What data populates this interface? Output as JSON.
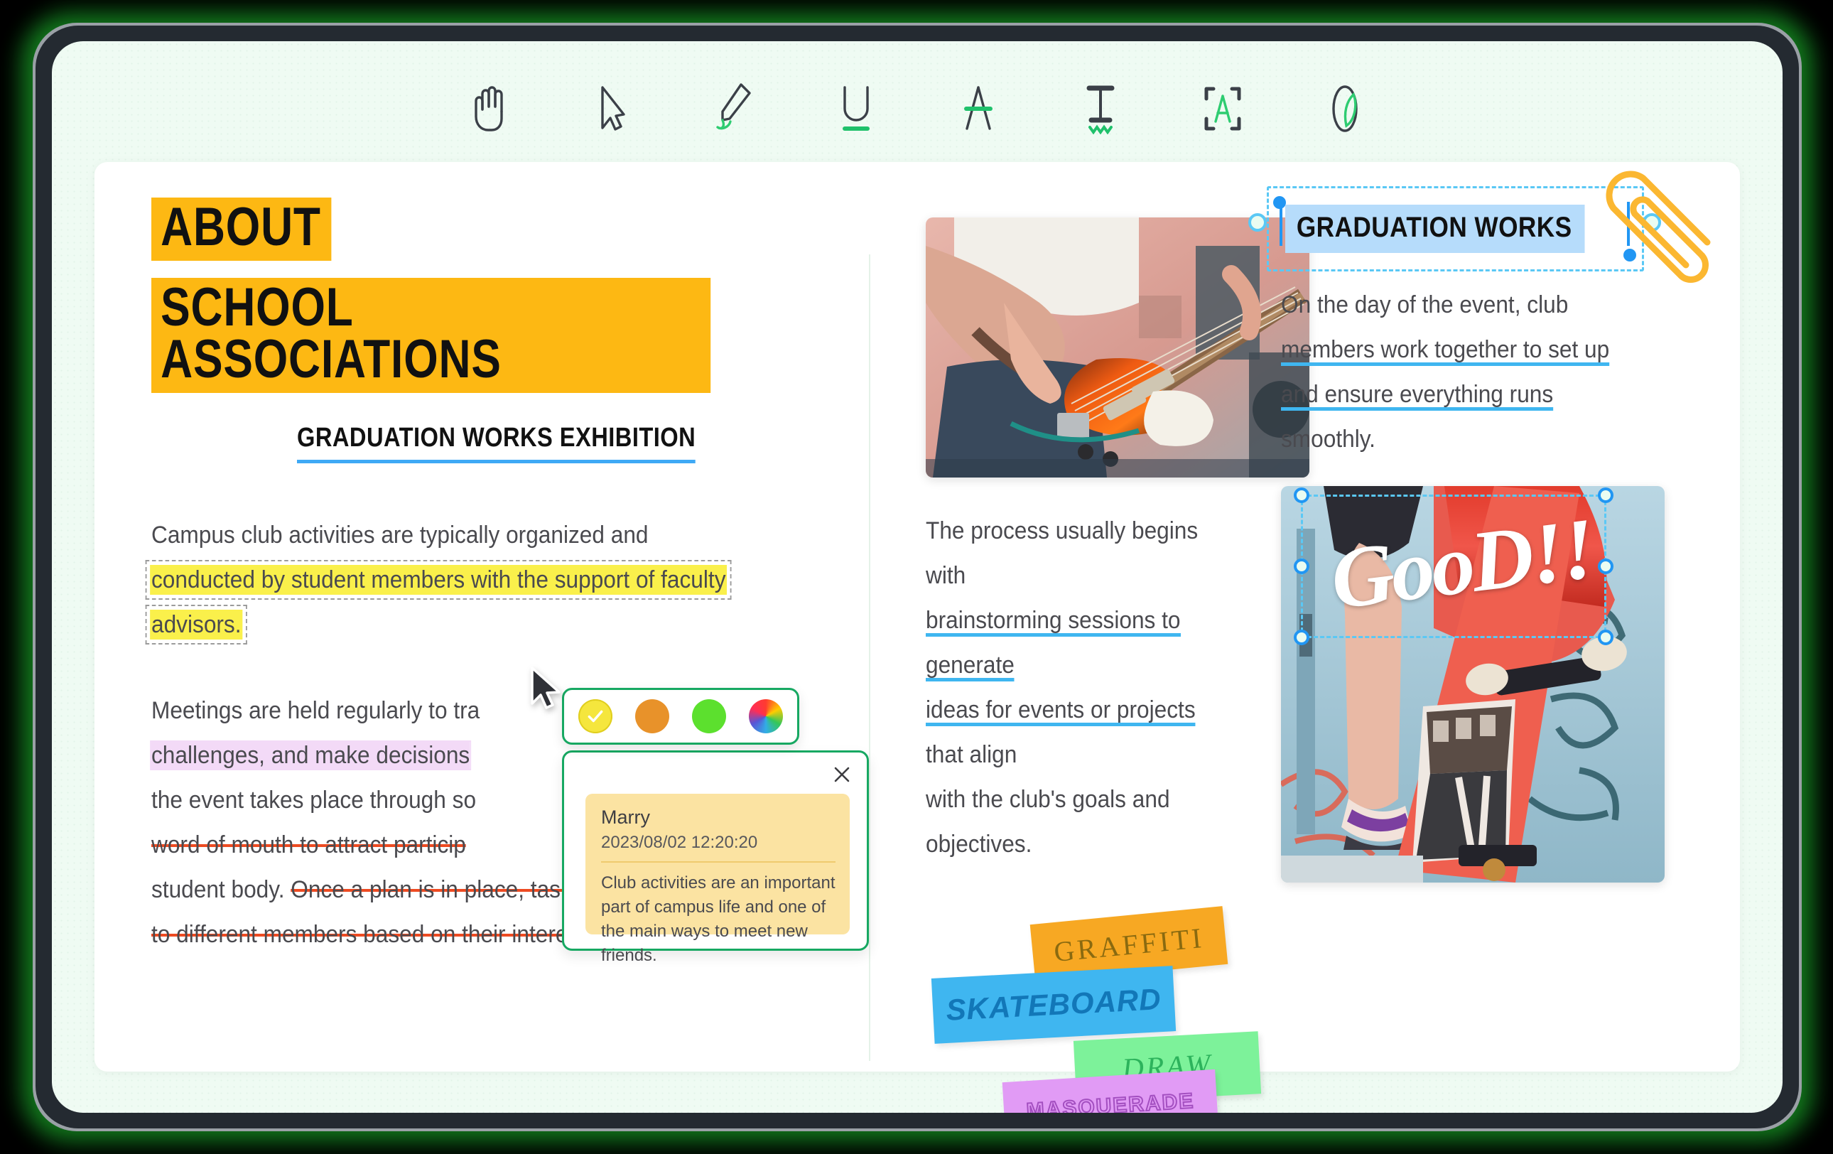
{
  "toolbar": {
    "tools": [
      {
        "name": "hand-tool",
        "label": "Hand"
      },
      {
        "name": "select-tool",
        "label": "Select"
      },
      {
        "name": "highlighter-pen-tool",
        "label": "Highlighter Pen"
      },
      {
        "name": "underline-tool",
        "label": "Underline"
      },
      {
        "name": "strikethrough-tool",
        "label": "Strikethrough"
      },
      {
        "name": "squiggly-underline-tool",
        "label": "Squiggly Underline"
      },
      {
        "name": "text-box-tool",
        "label": "Text Box"
      },
      {
        "name": "shape-highlight-tool",
        "label": "Shape Highlight"
      }
    ]
  },
  "document": {
    "col1": {
      "heading_top": "ABOUT",
      "heading_main": "SCHOOL ASSOCIATIONS",
      "subheading": "GRADUATION WORKS EXHIBITION",
      "para1_plain_a": "Campus club activities are typically organized and ",
      "para1_highlight_line1": "conducted by student members with the support of faculty",
      "para1_highlight_line2": "advisors.",
      "para2_plain_a": "Meetings are held regularly to tra",
      "para2_highlight": "challenges, and make decisions",
      "para2_plain_b": "the event takes place through so",
      "para2_strike_a": "word of mouth to attract particip",
      "para2_plain_c": "student body. ",
      "para2_strike_b": "Once a plan is in place, tasks are assigned",
      "para2_strike_c": "to different members based on their interests and skills."
    },
    "col2": {
      "text_plain_a": "The process usually begins with ",
      "text_underline_a": "brainstorming sessions to generate",
      "text_underline_b": "ideas for events or projects",
      "text_plain_b": " that align",
      "text_plain_c": "with the club's goals and objectives."
    },
    "col3": {
      "selected_title": "GRADUATION WORKS",
      "text_plain_a": "On the day of the event, club",
      "text_underline_a": "members work together to set up",
      "text_underline_b": "and ensure everything runs ",
      "text_plain_b": "smoothly.",
      "image_overlay_text": "GooD!!"
    },
    "stickers": [
      {
        "name": "sticker-graffiti",
        "label": "GRAFFITI",
        "color": "#F7A823"
      },
      {
        "name": "sticker-skateboard",
        "label": "SKATEBOARD",
        "color": "#3FB6F0"
      },
      {
        "name": "sticker-draw",
        "label": "DRAW",
        "color": "#7DF29A"
      },
      {
        "name": "sticker-masquerade",
        "label": "MASQUERADE",
        "color": "#E19BF5"
      }
    ]
  },
  "color_picker": {
    "swatches": [
      {
        "name": "swatch-yellow",
        "color": "#F5E63D",
        "selected": true
      },
      {
        "name": "swatch-orange",
        "color": "#E8922A",
        "selected": false
      },
      {
        "name": "swatch-green",
        "color": "#5CE02E",
        "selected": false
      },
      {
        "name": "swatch-rainbow",
        "color": "rainbow",
        "selected": false
      }
    ]
  },
  "comment": {
    "author": "Marry",
    "timestamp": "2023/08/02 12:20:20",
    "body": "Club activities are an important part of campus life and one of the main ways to meet new friends.",
    "close_label": "✕"
  },
  "colors": {
    "accent_green": "#17a862",
    "highlight_yellow": "#FAF04B",
    "highlight_purple": "#F3DAF7",
    "strike_red": "#EE4B22",
    "underline_blue": "#3FB6F0",
    "title_orange": "#FDB813",
    "selection_blue": "#5AC8F5"
  }
}
